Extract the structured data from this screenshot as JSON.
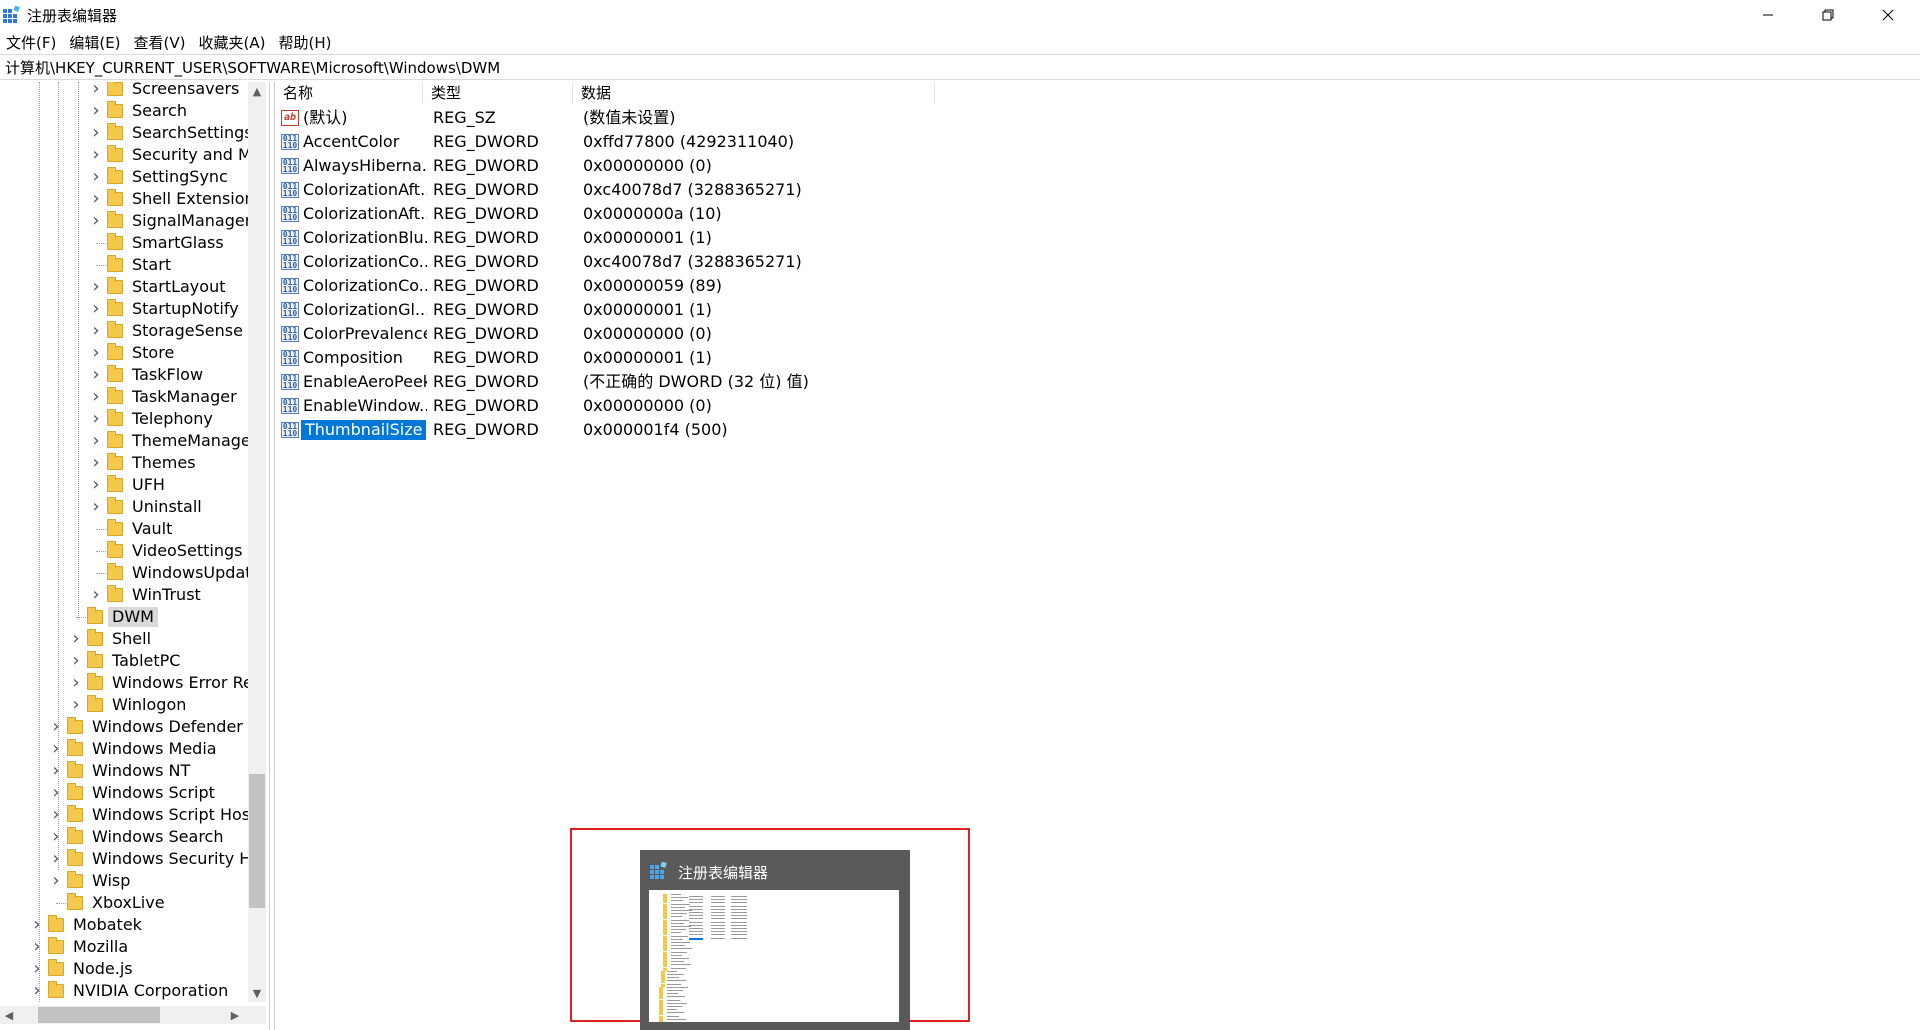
{
  "window": {
    "title": "注册表编辑器",
    "minimize_glyph": "—",
    "maximize_glyph": "❐",
    "close_glyph": "✕"
  },
  "menu": [
    "文件(F)",
    "编辑(E)",
    "查看(V)",
    "收藏夹(A)",
    "帮助(H)"
  ],
  "address": "计算机\\HKEY_CURRENT_USER\\SOFTWARE\\Microsoft\\Windows\\DWM",
  "tree": [
    {
      "label": "Screensavers",
      "level": 4,
      "expandable": true
    },
    {
      "label": "Search",
      "level": 4,
      "expandable": true
    },
    {
      "label": "SearchSettings",
      "level": 4,
      "expandable": true
    },
    {
      "label": "Security and Ma",
      "level": 4,
      "expandable": true
    },
    {
      "label": "SettingSync",
      "level": 4,
      "expandable": true
    },
    {
      "label": "Shell Extensions",
      "level": 4,
      "expandable": true
    },
    {
      "label": "SignalManager",
      "level": 4,
      "expandable": true
    },
    {
      "label": "SmartGlass",
      "level": 4,
      "expandable": false
    },
    {
      "label": "Start",
      "level": 4,
      "expandable": false
    },
    {
      "label": "StartLayout",
      "level": 4,
      "expandable": true
    },
    {
      "label": "StartupNotify",
      "level": 4,
      "expandable": true
    },
    {
      "label": "StorageSense",
      "level": 4,
      "expandable": true
    },
    {
      "label": "Store",
      "level": 4,
      "expandable": true
    },
    {
      "label": "TaskFlow",
      "level": 4,
      "expandable": true
    },
    {
      "label": "TaskManager",
      "level": 4,
      "expandable": true
    },
    {
      "label": "Telephony",
      "level": 4,
      "expandable": true
    },
    {
      "label": "ThemeManager",
      "level": 4,
      "expandable": true
    },
    {
      "label": "Themes",
      "level": 4,
      "expandable": true
    },
    {
      "label": "UFH",
      "level": 4,
      "expandable": true
    },
    {
      "label": "Uninstall",
      "level": 4,
      "expandable": true
    },
    {
      "label": "Vault",
      "level": 4,
      "expandable": false
    },
    {
      "label": "VideoSettings",
      "level": 4,
      "expandable": false
    },
    {
      "label": "WindowsUpdate",
      "level": 4,
      "expandable": false
    },
    {
      "label": "WinTrust",
      "level": 4,
      "expandable": true
    },
    {
      "label": "DWM",
      "level": 3,
      "expandable": false,
      "selected": true
    },
    {
      "label": "Shell",
      "level": 3,
      "expandable": true
    },
    {
      "label": "TabletPC",
      "level": 3,
      "expandable": true
    },
    {
      "label": "Windows Error Rep",
      "level": 3,
      "expandable": true
    },
    {
      "label": "Winlogon",
      "level": 3,
      "expandable": true
    },
    {
      "label": "Windows Defender Se",
      "level": 2,
      "expandable": true
    },
    {
      "label": "Windows Media",
      "level": 2,
      "expandable": true
    },
    {
      "label": "Windows NT",
      "level": 2,
      "expandable": true
    },
    {
      "label": "Windows Script",
      "level": 2,
      "expandable": true
    },
    {
      "label": "Windows Script Host",
      "level": 2,
      "expandable": true
    },
    {
      "label": "Windows Search",
      "level": 2,
      "expandable": true
    },
    {
      "label": "Windows Security He",
      "level": 2,
      "expandable": true
    },
    {
      "label": "Wisp",
      "level": 2,
      "expandable": true
    },
    {
      "label": "XboxLive",
      "level": 2,
      "expandable": false
    },
    {
      "label": "Mobatek",
      "level": 1,
      "expandable": true
    },
    {
      "label": "Mozilla",
      "level": 1,
      "expandable": true
    },
    {
      "label": "Node.js",
      "level": 1,
      "expandable": true
    },
    {
      "label": "NVIDIA Corporation",
      "level": 1,
      "expandable": true
    }
  ],
  "columns": {
    "name": "名称",
    "type": "类型",
    "data": "数据"
  },
  "values": [
    {
      "icon": "ab",
      "name": "(默认)",
      "type": "REG_SZ",
      "data": "(数值未设置)"
    },
    {
      "icon": "bin",
      "name": "AccentColor",
      "type": "REG_DWORD",
      "data": "0xffd77800 (4292311040)"
    },
    {
      "icon": "bin",
      "name": "AlwaysHiberna...",
      "type": "REG_DWORD",
      "data": "0x00000000 (0)"
    },
    {
      "icon": "bin",
      "name": "ColorizationAft...",
      "type": "REG_DWORD",
      "data": "0xc40078d7 (3288365271)"
    },
    {
      "icon": "bin",
      "name": "ColorizationAft...",
      "type": "REG_DWORD",
      "data": "0x0000000a (10)"
    },
    {
      "icon": "bin",
      "name": "ColorizationBlu...",
      "type": "REG_DWORD",
      "data": "0x00000001 (1)"
    },
    {
      "icon": "bin",
      "name": "ColorizationCo...",
      "type": "REG_DWORD",
      "data": "0xc40078d7 (3288365271)"
    },
    {
      "icon": "bin",
      "name": "ColorizationCo...",
      "type": "REG_DWORD",
      "data": "0x00000059 (89)"
    },
    {
      "icon": "bin",
      "name": "ColorizationGl...",
      "type": "REG_DWORD",
      "data": "0x00000001 (1)"
    },
    {
      "icon": "bin",
      "name": "ColorPrevalence",
      "type": "REG_DWORD",
      "data": "0x00000000 (0)"
    },
    {
      "icon": "bin",
      "name": "Composition",
      "type": "REG_DWORD",
      "data": "0x00000001 (1)"
    },
    {
      "icon": "bin",
      "name": "EnableAeroPeek",
      "type": "REG_DWORD",
      "data": "(不正确的 DWORD  (32 位) 值)"
    },
    {
      "icon": "bin",
      "name": "EnableWindow...",
      "type": "REG_DWORD",
      "data": "0x00000000 (0)"
    },
    {
      "icon": "bin",
      "name": "ThumbnailSize",
      "type": "REG_DWORD",
      "data": "0x000001f4 (500)",
      "selected": true
    }
  ],
  "taskbar_preview": {
    "title": "注册表编辑器"
  },
  "colors": {
    "selection": "#0078d7",
    "tree_selection": "#d9d9d9",
    "folder": "#f4c84a",
    "highlight_box": "#e02020",
    "preview_bg": "#5a5a5a"
  }
}
